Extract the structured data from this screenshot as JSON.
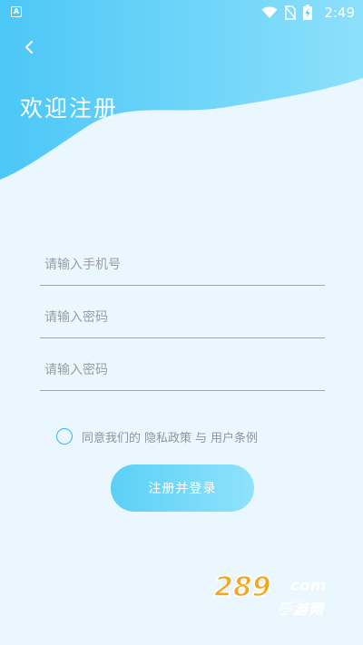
{
  "status_bar": {
    "time": "2:49",
    "app_icon_letter": "A"
  },
  "header": {
    "title": "欢迎注册"
  },
  "form": {
    "phone_placeholder": "请输入手机号",
    "password_placeholder": "请输入密码",
    "confirm_password_placeholder": "请输入密码"
  },
  "agreement": {
    "prefix": "同意我们的",
    "privacy_link": "隐私政策",
    "conjunction": "与",
    "terms_link": "用户条例",
    "checked": false
  },
  "submit": {
    "label": "注册并登录"
  },
  "watermark": {
    "number": "289",
    "domain": "com",
    "chinese": "手游网"
  },
  "colors": {
    "header_gradient_start": "#4cc7f7",
    "header_gradient_end": "#8ce0fb",
    "background": "#eaf7fe",
    "accent": "#3bb3ea",
    "button_gradient_start": "#5bd0f6",
    "button_gradient_end": "#8fe2fb"
  }
}
